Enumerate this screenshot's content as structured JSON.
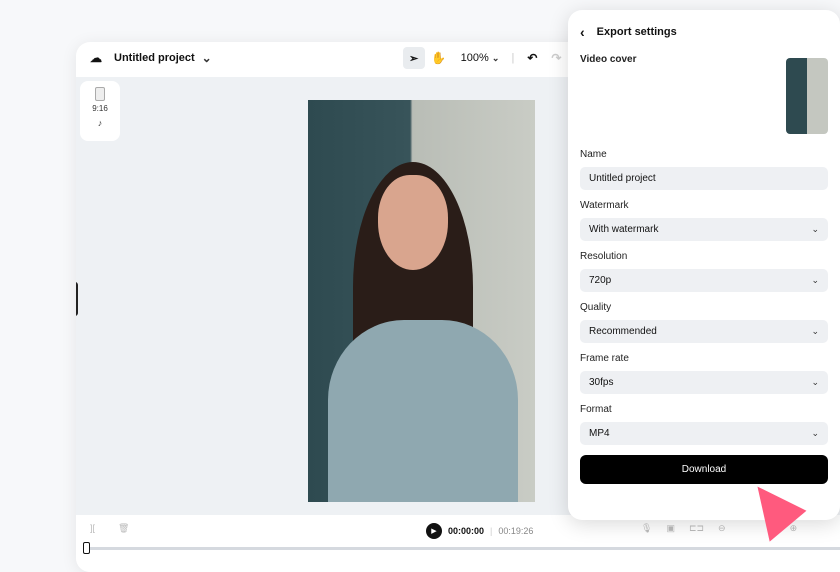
{
  "editor": {
    "project_title": "Untitled project",
    "zoom": "100%",
    "ratio_label": "9:16",
    "current_time": "00:00:00",
    "total_time": "00:19:26"
  },
  "export": {
    "title": "Export settings",
    "video_cover_label": "Video cover",
    "fields": [
      {
        "label": "Name",
        "value": "Untitled project",
        "dropdown": false
      },
      {
        "label": "Watermark",
        "value": "With watermark",
        "dropdown": true
      },
      {
        "label": "Resolution",
        "value": "720p",
        "dropdown": true
      },
      {
        "label": "Quality",
        "value": "Recommended",
        "dropdown": true
      },
      {
        "label": "Frame rate",
        "value": "30fps",
        "dropdown": true
      },
      {
        "label": "Format",
        "value": "MP4",
        "dropdown": true
      }
    ],
    "download_label": "Download"
  },
  "colors": {
    "accent": "#ff5a7e",
    "button": "#000000"
  }
}
